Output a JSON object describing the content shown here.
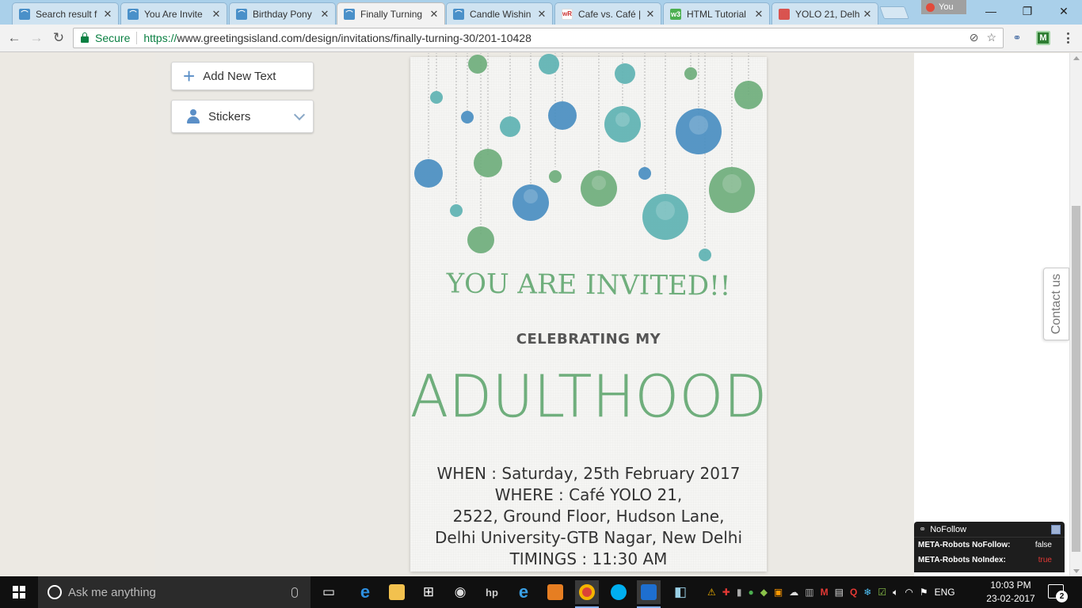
{
  "browser": {
    "tabs": [
      {
        "title": "Search result f",
        "icon": "greetingsisland-favicon",
        "active": false
      },
      {
        "title": "You Are Invite",
        "icon": "greetingsisland-favicon",
        "active": false
      },
      {
        "title": "Birthday Pony",
        "icon": "greetingsisland-favicon",
        "active": false
      },
      {
        "title": "Finally Turning",
        "icon": "greetingsisland-favicon",
        "active": true
      },
      {
        "title": "Candle Wishin",
        "icon": "greetingsisland-favicon",
        "active": false
      },
      {
        "title": "Cafe vs. Café |",
        "icon": "wordreference-favicon",
        "active": false
      },
      {
        "title": "HTML Tutorial",
        "icon": "w3schools-favicon",
        "active": false
      },
      {
        "title": "YOLO 21, Delh",
        "icon": "zomato-favicon",
        "active": false
      }
    ],
    "profile_label": "You",
    "secure_label": "Secure",
    "url_scheme": "https://",
    "url_rest": "www.greetingsisland.com/design/invitations/finally-turning-30/201-10428"
  },
  "editor": {
    "add_text_label": "Add New Text",
    "stickers_label": "Stickers"
  },
  "invitation": {
    "headline": "YOU ARE INVITED!!",
    "subheading": "CELEBRATING MY",
    "feature_word": "ADULTHOOD",
    "details": [
      "WHEN : Saturday, 25th February 2017",
      "WHERE : Café YOLO 21,",
      "2522, Ground Floor, Hudson Lane,",
      "Delhi University-GTB Nagar, New Delhi",
      "TIMINGS : 11:30 AM"
    ],
    "colors": {
      "green": "#6fae7c",
      "teal": "#5fb3b3",
      "blue": "#4a8fc2"
    }
  },
  "contact_label": "Contact us",
  "nofollow": {
    "title": "NoFollow",
    "rows": [
      {
        "label": "META-Robots NoFollow:",
        "value": "false",
        "highlight": false
      },
      {
        "label": "META-Robots NoIndex:",
        "value": "true",
        "highlight": true
      }
    ]
  },
  "taskbar": {
    "search_placeholder": "Ask me anything",
    "language": "ENG",
    "time": "10:03 PM",
    "date": "23-02-2017",
    "notification_count": "2"
  }
}
